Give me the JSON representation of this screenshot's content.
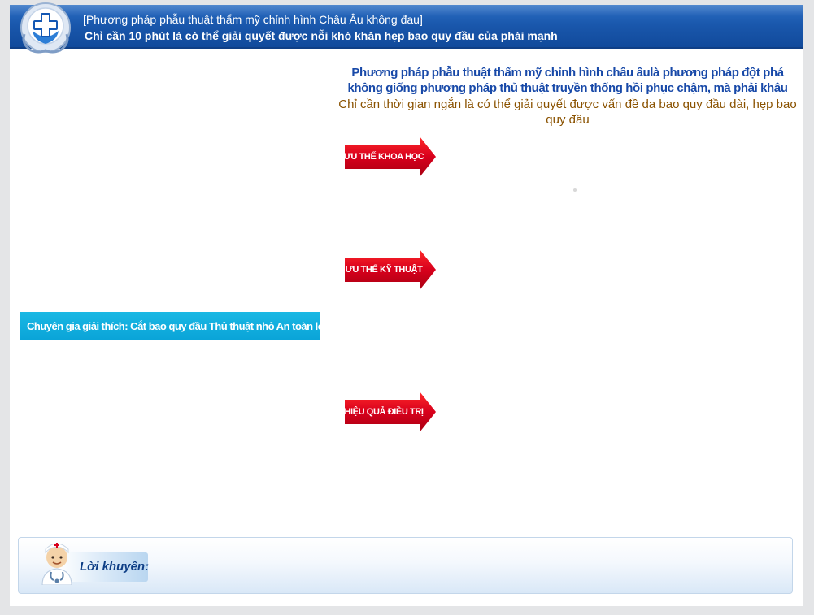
{
  "header": {
    "line1": "[Phương pháp phẫu thuật thẩm mỹ chỉnh hình Châu Âu không đau]",
    "line2": "Chỉ cần 10 phút là có thể giải quyết được nỗi khó khăn hẹp bao quy đầu của phái mạnh",
    "logo_icon": "medical-cross-shield-icon"
  },
  "intro": {
    "headline": "Phương pháp phẫu thuật thẩm mỹ chỉnh hình châu âulà phương pháp đột phá không giống phương pháp thủ thuật truyền thống hồi phục chậm, mà phải khâu",
    "subline": "Chỉ cần thời gian ngắn là có thể giải quyết được vấn đề da bao quy đầu dài, hẹp bao quy đầu"
  },
  "sections": [
    {
      "label": "ƯU THẾ KHOA HỌC"
    },
    {
      "label": "ƯU THẾ KỸ THUẬT"
    },
    {
      "label": "HIỆU QUẢ ĐIỀU TRỊ"
    }
  ],
  "expert": {
    "label": "Chuyên gia giải thích: Cắt bao quy đầu  Thủ thuật nhỏ  An toàn lớn"
  },
  "advice": {
    "label": "Lời khuyên:",
    "icon": "doctor-avatar-icon"
  },
  "colors": {
    "header_blue": "#1a58ad",
    "headline_blue": "#1849a8",
    "subline_brown": "#8a5200",
    "arrow_red": "#d8001c",
    "expert_cyan": "#0aa4d8"
  }
}
